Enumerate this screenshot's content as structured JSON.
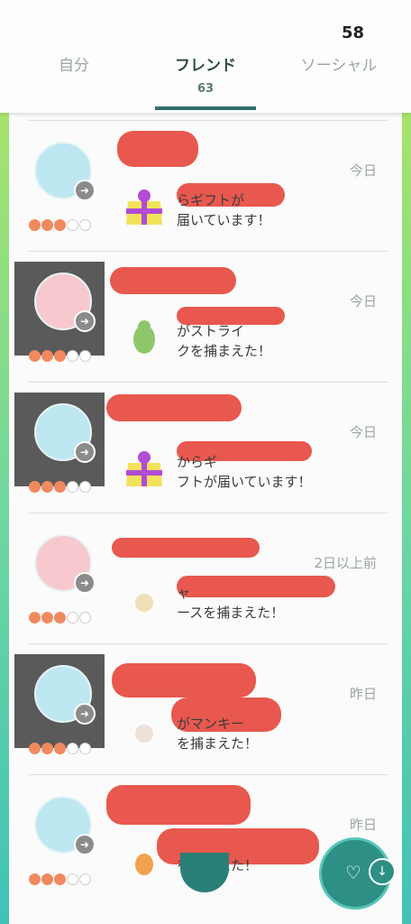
{
  "status": {
    "number": "58"
  },
  "tabs": [
    {
      "label": "自分"
    },
    {
      "label": "フレンド",
      "count": "63"
    },
    {
      "label": "ソーシャル"
    }
  ],
  "rows": [
    {
      "time": "今日",
      "message": "らギフトが\n届いています！",
      "hearts": [
        1,
        1,
        1,
        0,
        0
      ]
    },
    {
      "time": "今日",
      "message": "がストライ\nクを捕まえた！",
      "hearts": [
        1,
        1,
        1,
        0,
        0
      ]
    },
    {
      "time": "今日",
      "message": "からギ\nフトが届いています！",
      "hearts": [
        1,
        1,
        1,
        0,
        0
      ]
    },
    {
      "time": "2日以上前",
      "message": "ャ\nースを捕まえた！",
      "hearts": [
        1,
        1,
        1,
        0,
        0
      ]
    },
    {
      "time": "昨日",
      "message": "がマンキー\nを捕まえた！",
      "hearts": [
        1,
        1,
        1,
        0,
        0
      ]
    },
    {
      "time": "昨日",
      "message": "を捕まえた！",
      "hearts": [
        1,
        1,
        1,
        0,
        0
      ]
    }
  ],
  "colors": {
    "accent": "#2f6f6a",
    "heart": "#f08a5e",
    "redaction": "#e8584e"
  },
  "icons": {
    "gift": "gift-icon",
    "arrow": "arrow-right-icon",
    "heart_fab": "heart-icon",
    "download": "arrow-down-icon"
  }
}
